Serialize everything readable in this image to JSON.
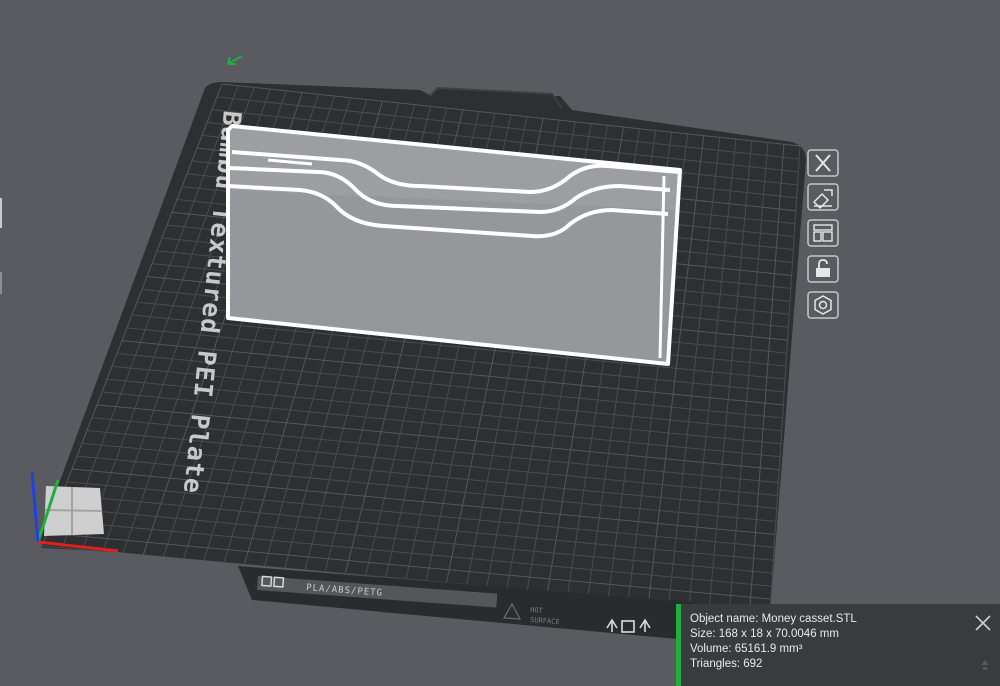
{
  "plate": {
    "name": "Bambu Textured PEI Plate",
    "filament_label": "PLA/ABS/PETG",
    "hot_surface_line1": "HOT",
    "hot_surface_line2": "SURFACE"
  },
  "tools": [
    {
      "name": "close-icon"
    },
    {
      "name": "auto-orient-icon"
    },
    {
      "name": "arrange-icon"
    },
    {
      "name": "lock-icon"
    },
    {
      "name": "plate-settings-icon"
    }
  ],
  "object_info": {
    "name_line": "Object name: Money casset.STL",
    "size_line": "Size: 168 x 18 x 70.0046 mm",
    "volume_line": "Volume: 65161.9 mm³",
    "triangles_line": "Triangles: 692"
  },
  "colors": {
    "background": "#5a5b60",
    "plate": "#2e2f32",
    "grid": "#4a4b4f",
    "model_face": "#9d9ea1",
    "model_outline": "#ffffff",
    "accent_green": "#1fae3f",
    "axis_x": "#e02020",
    "axis_y": "#1fae3f",
    "axis_z": "#2040e0"
  }
}
